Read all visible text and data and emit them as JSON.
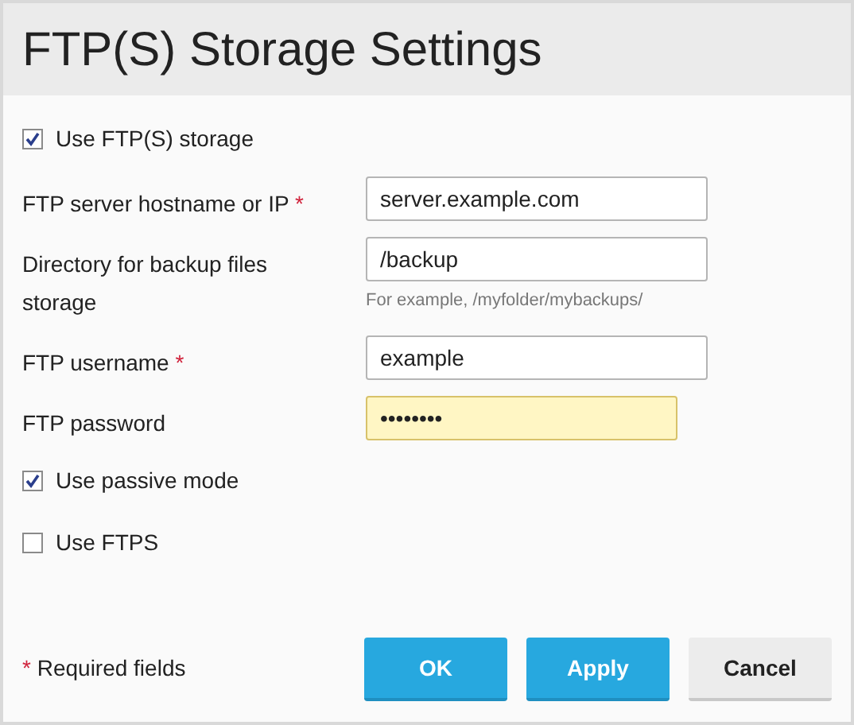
{
  "dialog": {
    "title": "FTP(S) Storage Settings"
  },
  "rows": [
    {
      "kind": "checkbox",
      "label": "Use FTP(S) storage",
      "checked": true
    },
    {
      "kind": "field",
      "label": "FTP server hostname or IP",
      "required_mark": "*",
      "value": "server.example.com",
      "highlighted": false
    },
    {
      "kind": "field",
      "label": "Directory for backup files storage",
      "value": "/backup",
      "hint": "For example, /myfolder/mybackups/",
      "highlighted": false
    },
    {
      "kind": "field",
      "label": "FTP username",
      "required_mark": "*",
      "value": "example",
      "highlighted": false
    },
    {
      "kind": "field",
      "label": "FTP password",
      "value": "••••••••",
      "highlighted": true
    },
    {
      "kind": "checkbox",
      "label": "Use passive mode",
      "checked": true
    },
    {
      "kind": "checkbox",
      "label": "Use FTPS",
      "checked": false
    }
  ],
  "footer": {
    "required_mark": "*",
    "required_note": "Required fields",
    "buttons": [
      {
        "label": "OK",
        "kind": "primary"
      },
      {
        "label": "Apply",
        "kind": "primary"
      },
      {
        "label": "Cancel",
        "kind": "secondary"
      }
    ]
  }
}
